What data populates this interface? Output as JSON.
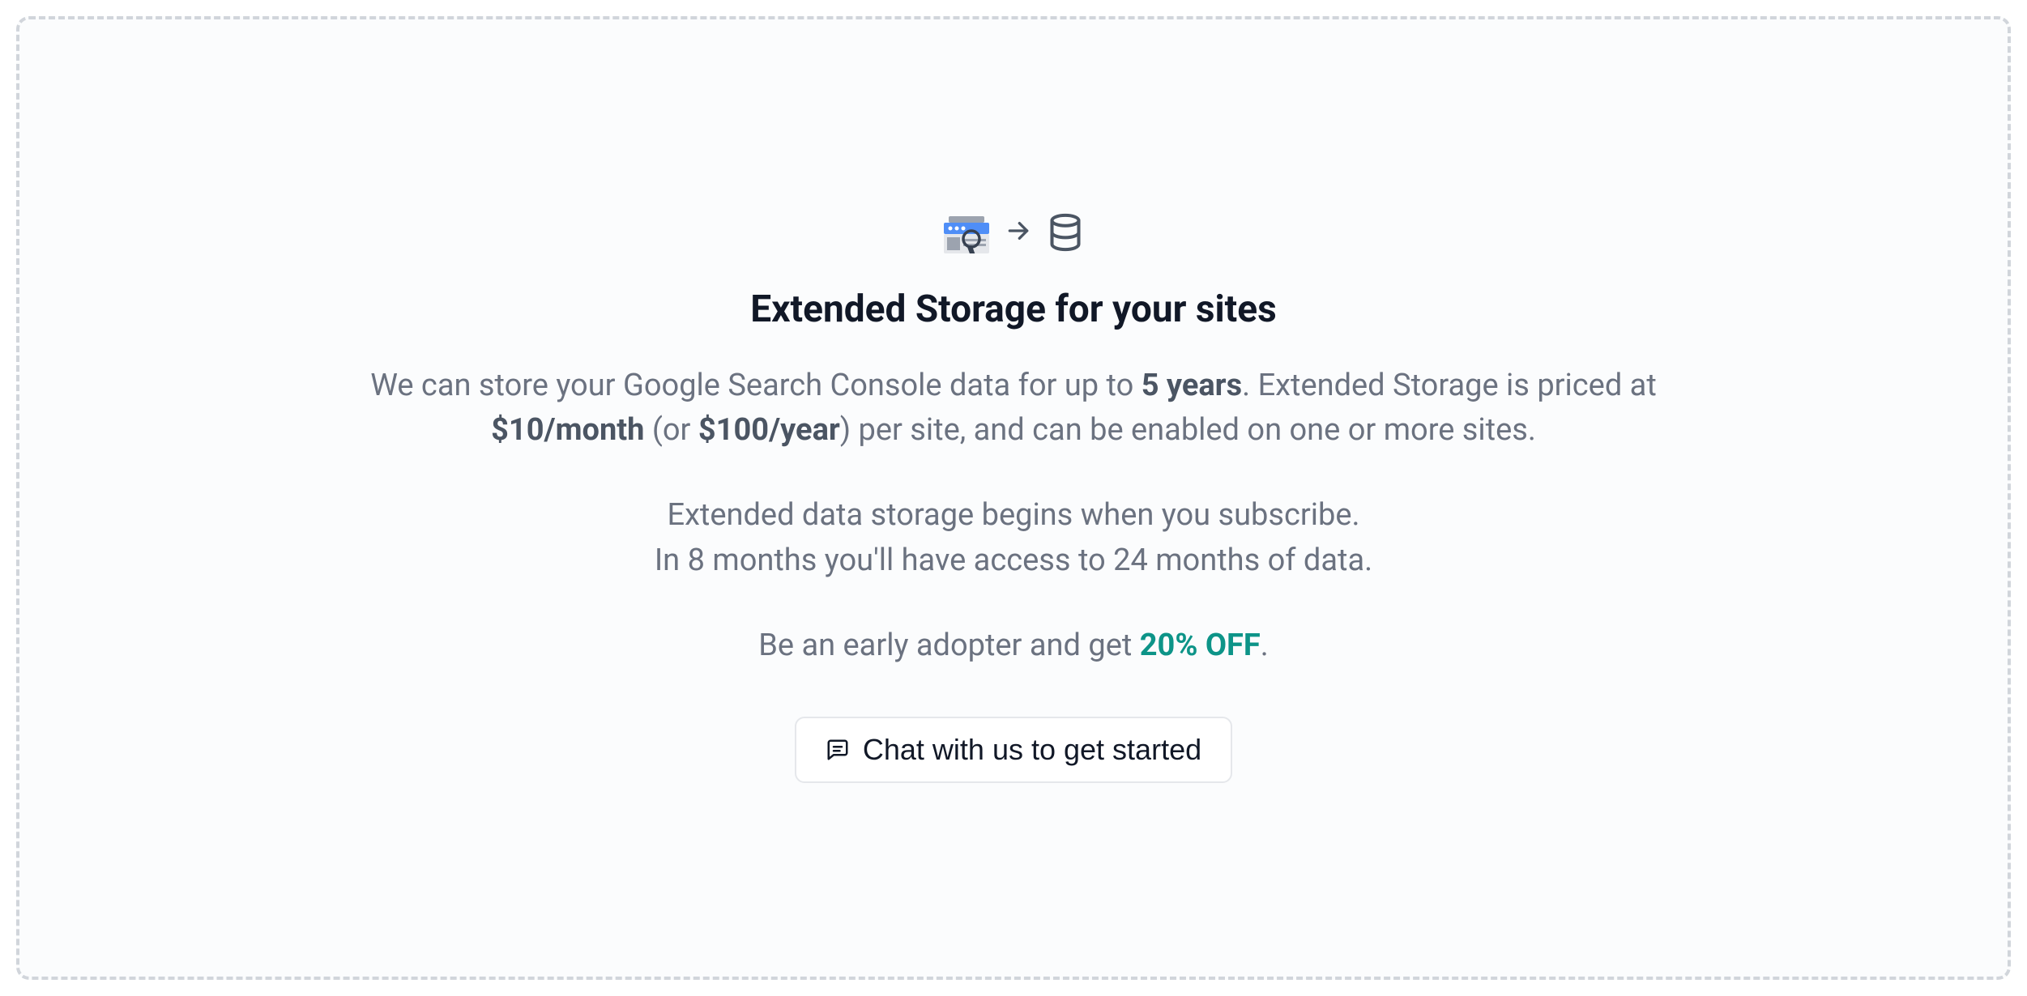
{
  "panel": {
    "title": "Extended Storage for your sites",
    "p1": {
      "t1": "We can store your Google Search Console data for up to ",
      "b1": "5 years",
      "t2": ". Extended Storage is priced at ",
      "b2": "$10/month",
      "t3": " (or ",
      "b3": "$100/year",
      "t4": ") per site, and can be enabled on one or more sites."
    },
    "p2": {
      "t1": "Extended data storage begins when you subscribe.",
      "t2": "In 8 months you'll have access to 24 months of data."
    },
    "p3": {
      "t1": "Be an early adopter and get ",
      "d1": "20% OFF",
      "t2": "."
    },
    "chat_label": "Chat with us to get started"
  }
}
